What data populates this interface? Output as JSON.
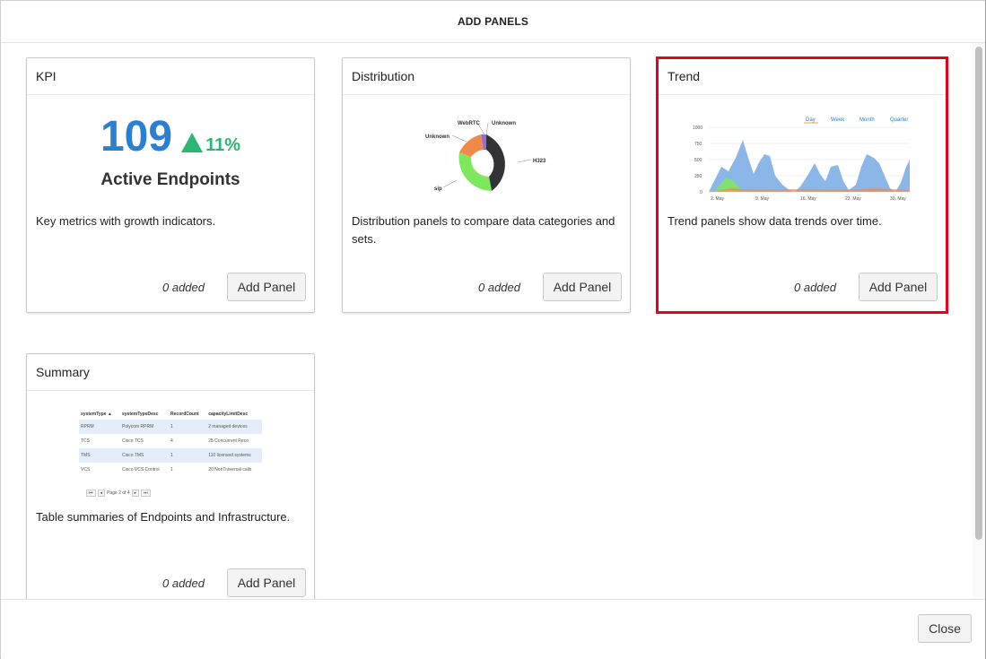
{
  "modal": {
    "title": "ADD PANELS",
    "close_label": "Close"
  },
  "cards": [
    {
      "title": "KPI",
      "description": "Key metrics with growth indicators.",
      "count": "0 added",
      "button": "Add Panel"
    },
    {
      "title": "Distribution",
      "description": "Distribution panels to compare data categories and sets.",
      "count": "0 added",
      "button": "Add Panel"
    },
    {
      "title": "Trend",
      "description": "Trend panels show data trends over time.",
      "count": "0 added",
      "button": "Add Panel"
    },
    {
      "title": "Summary",
      "description": "Table summaries of Endpoints and Infrastructure.",
      "count": "0 added",
      "button": "Add Panel"
    }
  ],
  "kpi_preview": {
    "value": "109",
    "growth": "11%",
    "label": "Active Endpoints"
  },
  "distribution_preview": {
    "labels": {
      "webrtc": "WebRTC",
      "unknown_top": "Unknown",
      "unknown_left": "Unknown",
      "h323": "H323",
      "sip": "sip"
    }
  },
  "trend_preview": {
    "tabs": [
      "Day",
      "Week",
      "Month",
      "Quarter"
    ],
    "y_ticks": [
      "1000",
      "750",
      "500",
      "250",
      "0"
    ],
    "x_ticks": [
      "2. May",
      "9. May",
      "16. May",
      "23. May",
      "30. May"
    ]
  },
  "summary_preview": {
    "headers": [
      "systemType ▲",
      "systemTypeDesc",
      "RecordCount",
      "capacityLimitDesc"
    ],
    "rows": [
      [
        "RPRM",
        "Polycom RPRM",
        "1",
        "2 managed devices"
      ],
      [
        "TCS",
        "Cisco TCS",
        "4",
        "25 Concurrent Reco"
      ],
      [
        "TMS",
        "Cisco TMS",
        "1",
        "110 licensed systems"
      ],
      [
        "VCS",
        "Cisco VCS Control",
        "1",
        "20 NonTraversal calls"
      ]
    ],
    "pager": "Page 2 of 4"
  },
  "colors": {
    "accent_red": "#e8001c",
    "kpi_blue": "#2a7fd4",
    "kpi_green": "#2bb673"
  }
}
